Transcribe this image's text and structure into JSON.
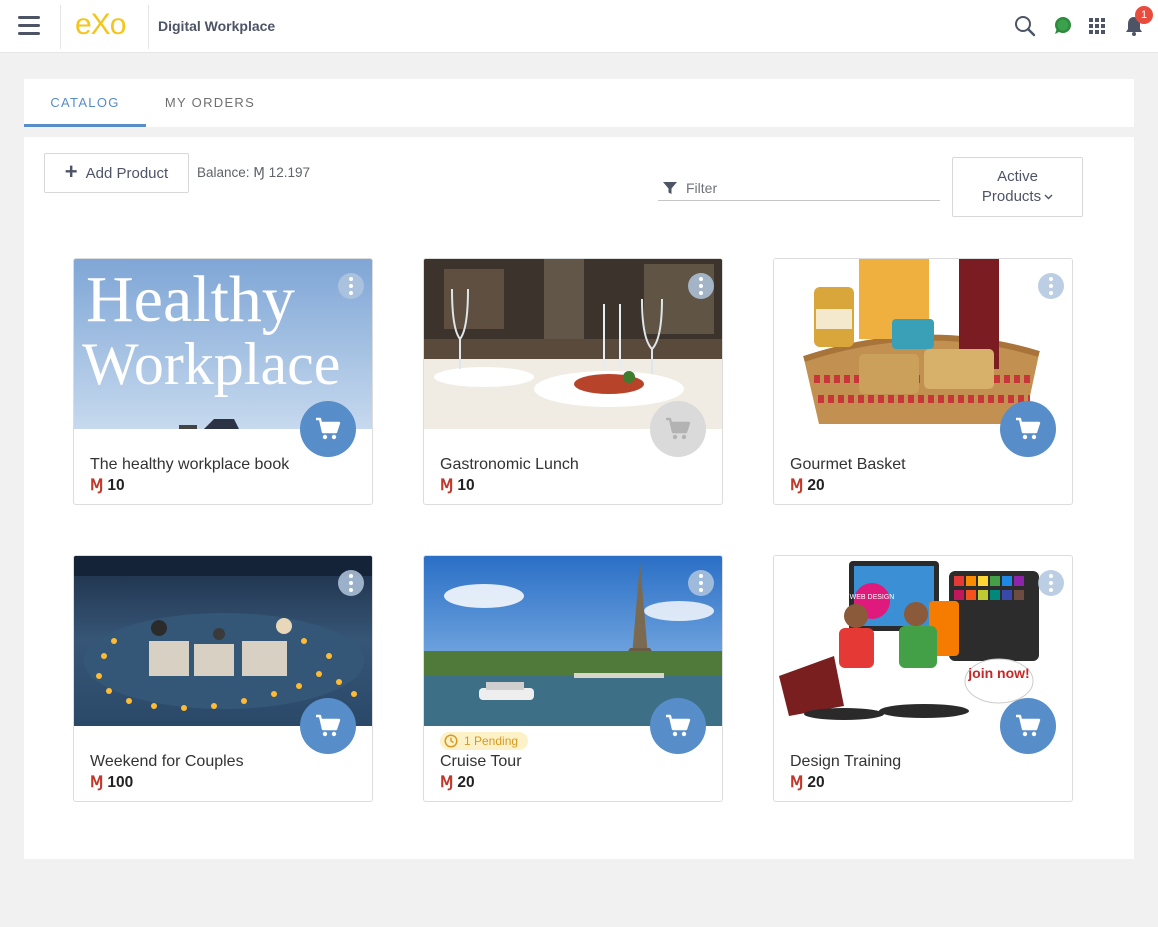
{
  "header": {
    "logo_text": "eXo",
    "app_title": "Digital Workplace",
    "notification_count": "1",
    "icons": [
      "menu-icon",
      "search-icon",
      "chat-icon",
      "apps-grid-icon",
      "bell-icon"
    ]
  },
  "tabs": [
    {
      "label": "CATALOG",
      "active": true
    },
    {
      "label": "MY ORDERS",
      "active": false
    }
  ],
  "toolbar": {
    "add_product_label": "Add Product",
    "balance_label": "Balance: Ɱ 12.197",
    "filter_placeholder": "Filter",
    "status_filter_label_line1": "Active",
    "status_filter_label_line2": "Products"
  },
  "products": [
    {
      "title": "The healthy workplace book",
      "currency": "Ɱ",
      "price": "10",
      "cart_enabled": true,
      "pending": ""
    },
    {
      "title": "Gastronomic Lunch",
      "currency": "Ɱ",
      "price": "10",
      "cart_enabled": false,
      "pending": ""
    },
    {
      "title": "Gourmet Basket",
      "currency": "Ɱ",
      "price": "20",
      "cart_enabled": true,
      "pending": ""
    },
    {
      "title": "Weekend for Couples",
      "currency": "Ɱ",
      "price": "100",
      "cart_enabled": true,
      "pending": ""
    },
    {
      "title": "Cruise Tour",
      "currency": "Ɱ",
      "price": "20",
      "cart_enabled": true,
      "pending": "1 Pending"
    },
    {
      "title": "Design Training",
      "currency": "Ɱ",
      "price": "20",
      "cart_enabled": true,
      "pending": ""
    }
  ],
  "images": {
    "book_line1": "Healthy",
    "book_line2": "Workplace",
    "design_badge": "WEB DESIGN",
    "join_now": "join now!"
  },
  "colors": {
    "accent": "#578dc9",
    "currency": "#c0392b",
    "pending_bg": "#fcf1c7",
    "pending_text": "#d69a24",
    "logo": "#f4c51a",
    "badge": "#e74c3c"
  }
}
